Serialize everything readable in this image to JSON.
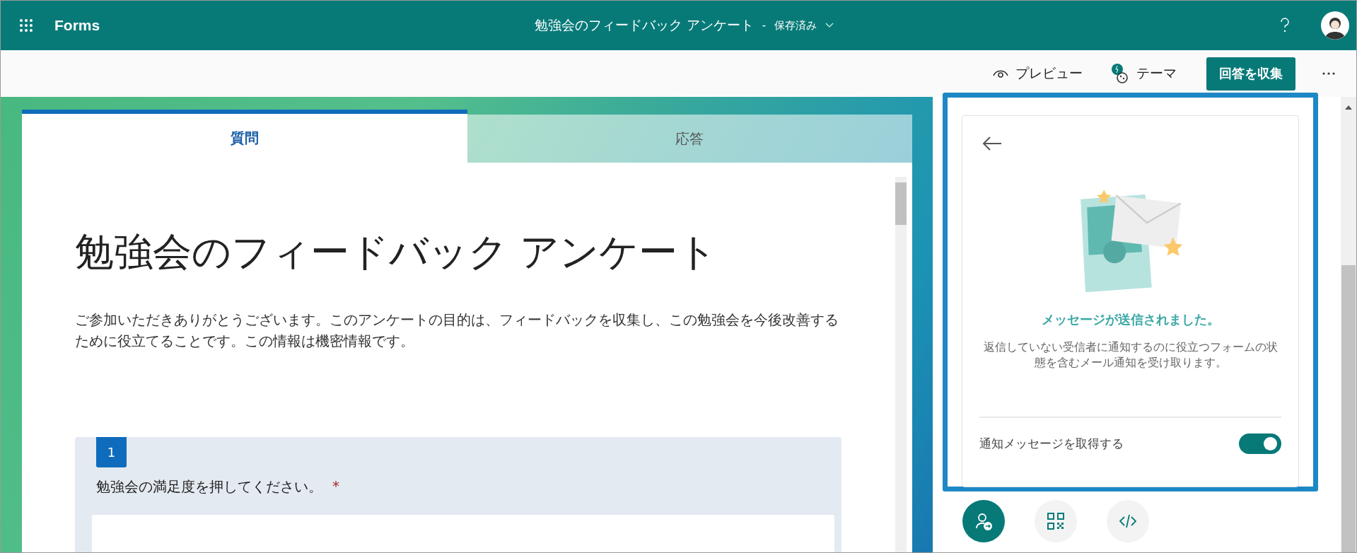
{
  "app_bar": {
    "app_name": "Forms",
    "title": "勉強会のフィードバック アンケート",
    "separator": "-",
    "save_status": "保存済み"
  },
  "toolbar": {
    "items": [
      {
        "kind": "preview",
        "label": "プレビュー"
      },
      {
        "kind": "theme",
        "label": "テーマ"
      },
      {
        "kind": "primary",
        "label": "回答を収集"
      }
    ]
  },
  "tabs": [
    {
      "label": "質問",
      "selected": true
    },
    {
      "label": "応答",
      "selected": false
    }
  ],
  "form": {
    "title": "勉強会のフィードバック アンケート",
    "description": "ご参加いただきありがとうございます。このアンケートの目的は、フィードバックを収集し、この勉強会を今後改善するために役立てることです。この情報は機密情報です。",
    "questions": [
      {
        "number": "1",
        "text": "勉強会の満足度を押してください。",
        "required": true,
        "required_mark": "*"
      }
    ]
  },
  "share_panel": {
    "heading": "メッセージが送信されました。",
    "message": "返信していない受信者に通知するのに役立つフォームの状態を含むメール通知を受け取ります。",
    "toggle": {
      "label": "通知メッセージを取得する",
      "on": true
    },
    "share_options": [
      {
        "kind": "invite",
        "selected": true
      },
      {
        "kind": "qr",
        "selected": false
      },
      {
        "kind": "embed",
        "selected": false
      }
    ]
  }
}
